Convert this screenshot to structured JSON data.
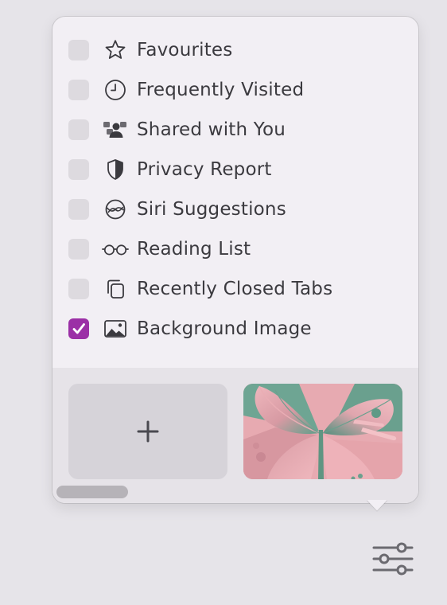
{
  "menu": {
    "items": [
      {
        "label": "Favourites",
        "icon": "star-icon",
        "checked": false
      },
      {
        "label": "Frequently Visited",
        "icon": "clock-icon",
        "checked": false
      },
      {
        "label": "Shared with You",
        "icon": "shared-people-icon",
        "checked": false
      },
      {
        "label": "Privacy Report",
        "icon": "shield-icon",
        "checked": false
      },
      {
        "label": "Siri Suggestions",
        "icon": "siri-icon",
        "checked": false
      },
      {
        "label": "Reading List",
        "icon": "glasses-icon",
        "checked": false
      },
      {
        "label": "Recently Closed Tabs",
        "icon": "tabs-icon",
        "checked": false
      },
      {
        "label": "Background Image",
        "icon": "photo-icon",
        "checked": true
      }
    ]
  },
  "background_picker": {
    "add_icon": "plus-icon",
    "image_description_icon": "butterfly-wallpaper"
  },
  "toolbar": {
    "settings_icon": "sliders-icon"
  },
  "colors": {
    "accent": "#9b2fa6",
    "popover": "#f2eff4",
    "background": "#e6e4e9"
  }
}
